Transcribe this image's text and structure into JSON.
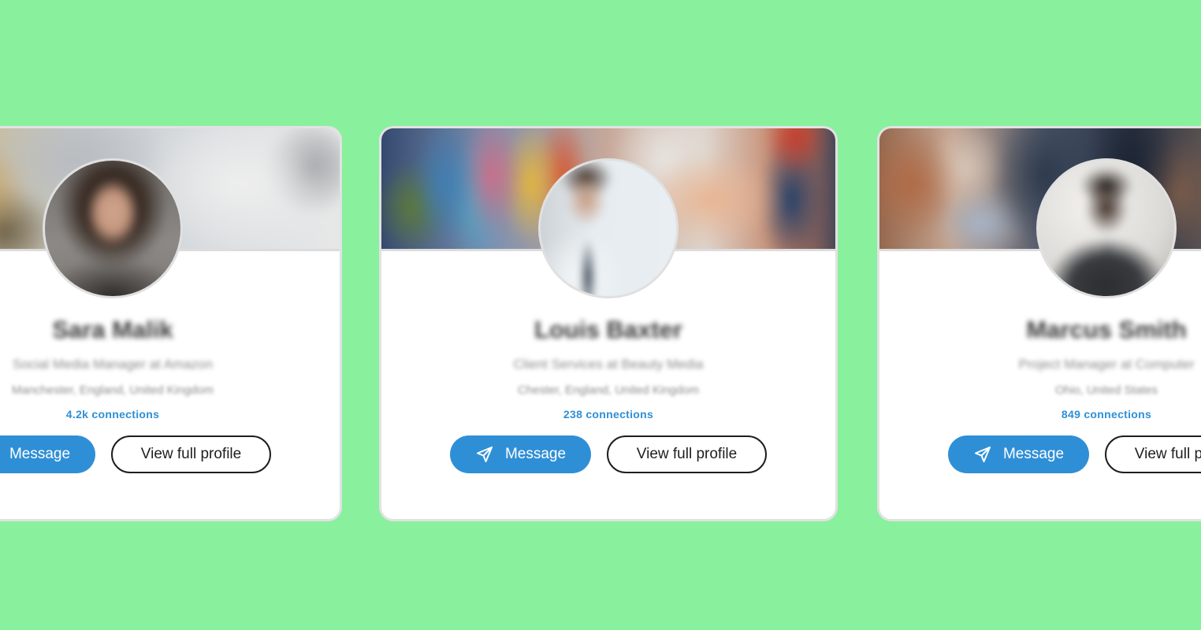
{
  "page": {
    "background_color": "#89f09e",
    "accent_color": "#2f8fd6"
  },
  "cards": [
    {
      "name": "Sara Malik",
      "headline": "Social Media Manager at Amazon",
      "location": "Manchester, England, United Kingdom",
      "connections": "4.2k connections",
      "message_label": "Message",
      "profile_label": "View full profile",
      "message_icon": "send-icon"
    },
    {
      "name": "Louis Baxter",
      "headline": "Client Services at Beauty Media",
      "location": "Chester, England, United Kingdom",
      "connections": "238 connections",
      "message_label": "Message",
      "profile_label": "View full profile",
      "message_icon": "send-icon"
    },
    {
      "name": "Marcus Smith",
      "headline": "Project Manager at Computer",
      "location": "Ohio, United States",
      "connections": "849 connections",
      "message_label": "Message",
      "profile_label": "View full profile",
      "message_icon": "send-icon"
    }
  ]
}
